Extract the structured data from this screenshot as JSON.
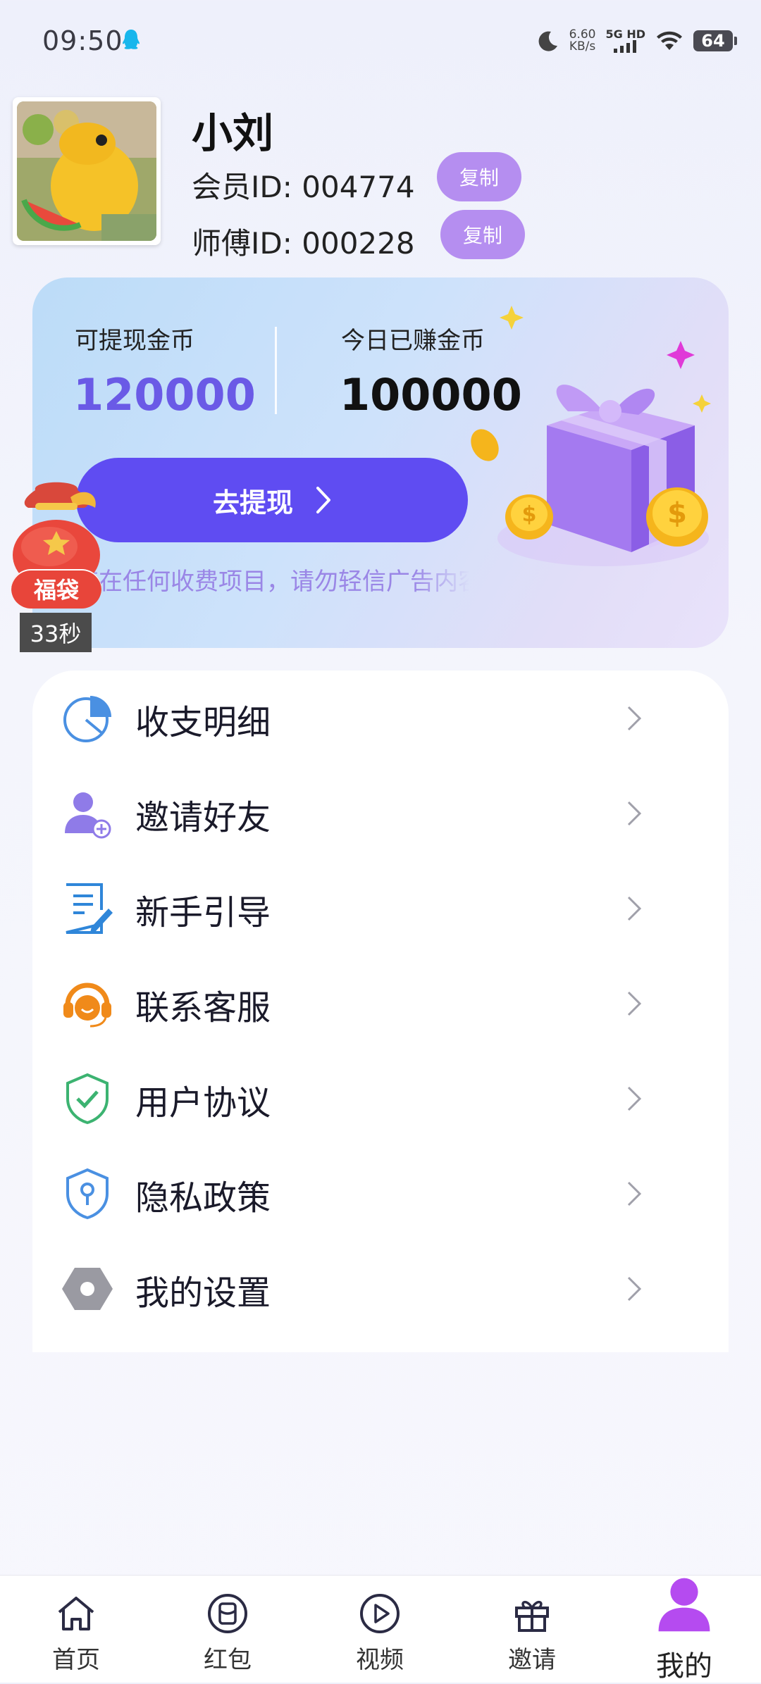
{
  "status_bar": {
    "time": "09:50",
    "speed_value": "6.60",
    "speed_unit": "KB/s",
    "network": "5G HD",
    "battery": "64"
  },
  "profile": {
    "name": "小刘",
    "member_id_label": "会员ID:",
    "member_id": "004774",
    "master_id_label": "师傅ID:",
    "master_id": "000228",
    "copy_label": "复制"
  },
  "wallet": {
    "withdrawable_label": "可提现金币",
    "withdrawable_value": "120000",
    "today_label": "今日已赚金币",
    "today_value": "100000",
    "withdraw_button": "去提现",
    "notice": "存在任何收费项目，请勿轻信广告内容，谨防诈骗"
  },
  "lucky_bag": {
    "label": "福袋",
    "timer": "33秒"
  },
  "menu": [
    {
      "label": "收支明细",
      "icon": "pie-chart-icon"
    },
    {
      "label": "邀请好友",
      "icon": "add-user-icon"
    },
    {
      "label": "新手引导",
      "icon": "guide-document-icon"
    },
    {
      "label": "联系客服",
      "icon": "headset-icon"
    },
    {
      "label": "用户协议",
      "icon": "shield-check-icon"
    },
    {
      "label": "隐私政策",
      "icon": "privacy-shield-icon"
    },
    {
      "label": "我的设置",
      "icon": "settings-hexagon-icon"
    }
  ],
  "bottom_nav": [
    {
      "label": "首页",
      "icon": "home-icon"
    },
    {
      "label": "红包",
      "icon": "red-packet-icon"
    },
    {
      "label": "视频",
      "icon": "video-play-icon"
    },
    {
      "label": "邀请",
      "icon": "gift-icon"
    },
    {
      "label": "我的",
      "icon": "profile-icon",
      "active": true
    }
  ],
  "colors": {
    "accent": "#5f4cf2",
    "value_purple": "#6a5ae6",
    "copy_button": "#b58ef0",
    "active_nav": "#b54bf0"
  }
}
